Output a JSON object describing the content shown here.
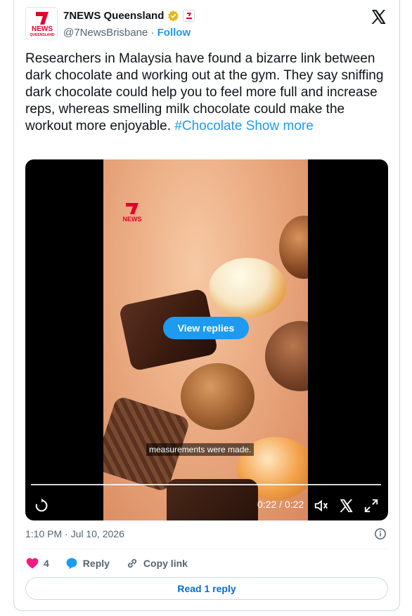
{
  "author": {
    "display_name": "7NEWS Queensland",
    "handle": "@7NewsBrisbane",
    "separator": "·",
    "follow_label": "Follow",
    "avatar_text_top": "NEWS",
    "avatar_text_bottom": "QUEENSLAND"
  },
  "tweet": {
    "text": "Researchers in Malaysia have found a bizarre link between dark chocolate and working out at the gym. They say sniffing dark chocolate could help you to feel more full and increase reps, whereas smelling milk chocolate could make the workout more enjoyable.",
    "hashtag": "#Chocolate",
    "show_more": "Show more"
  },
  "video": {
    "view_replies_label": "View replies",
    "caption": "measurements were made.",
    "time": "0:22 / 0:22",
    "progress": 1.0,
    "watermark": "NEWS"
  },
  "footer": {
    "timestamp": "1:10 PM · Jul 10, 2026",
    "like_count": "4",
    "reply_label": "Reply",
    "copy_link_label": "Copy link",
    "read_reply_label": "Read 1 reply"
  },
  "colors": {
    "accent": "#1d9bf0",
    "like": "#f91880",
    "verified": "#e2b719"
  }
}
